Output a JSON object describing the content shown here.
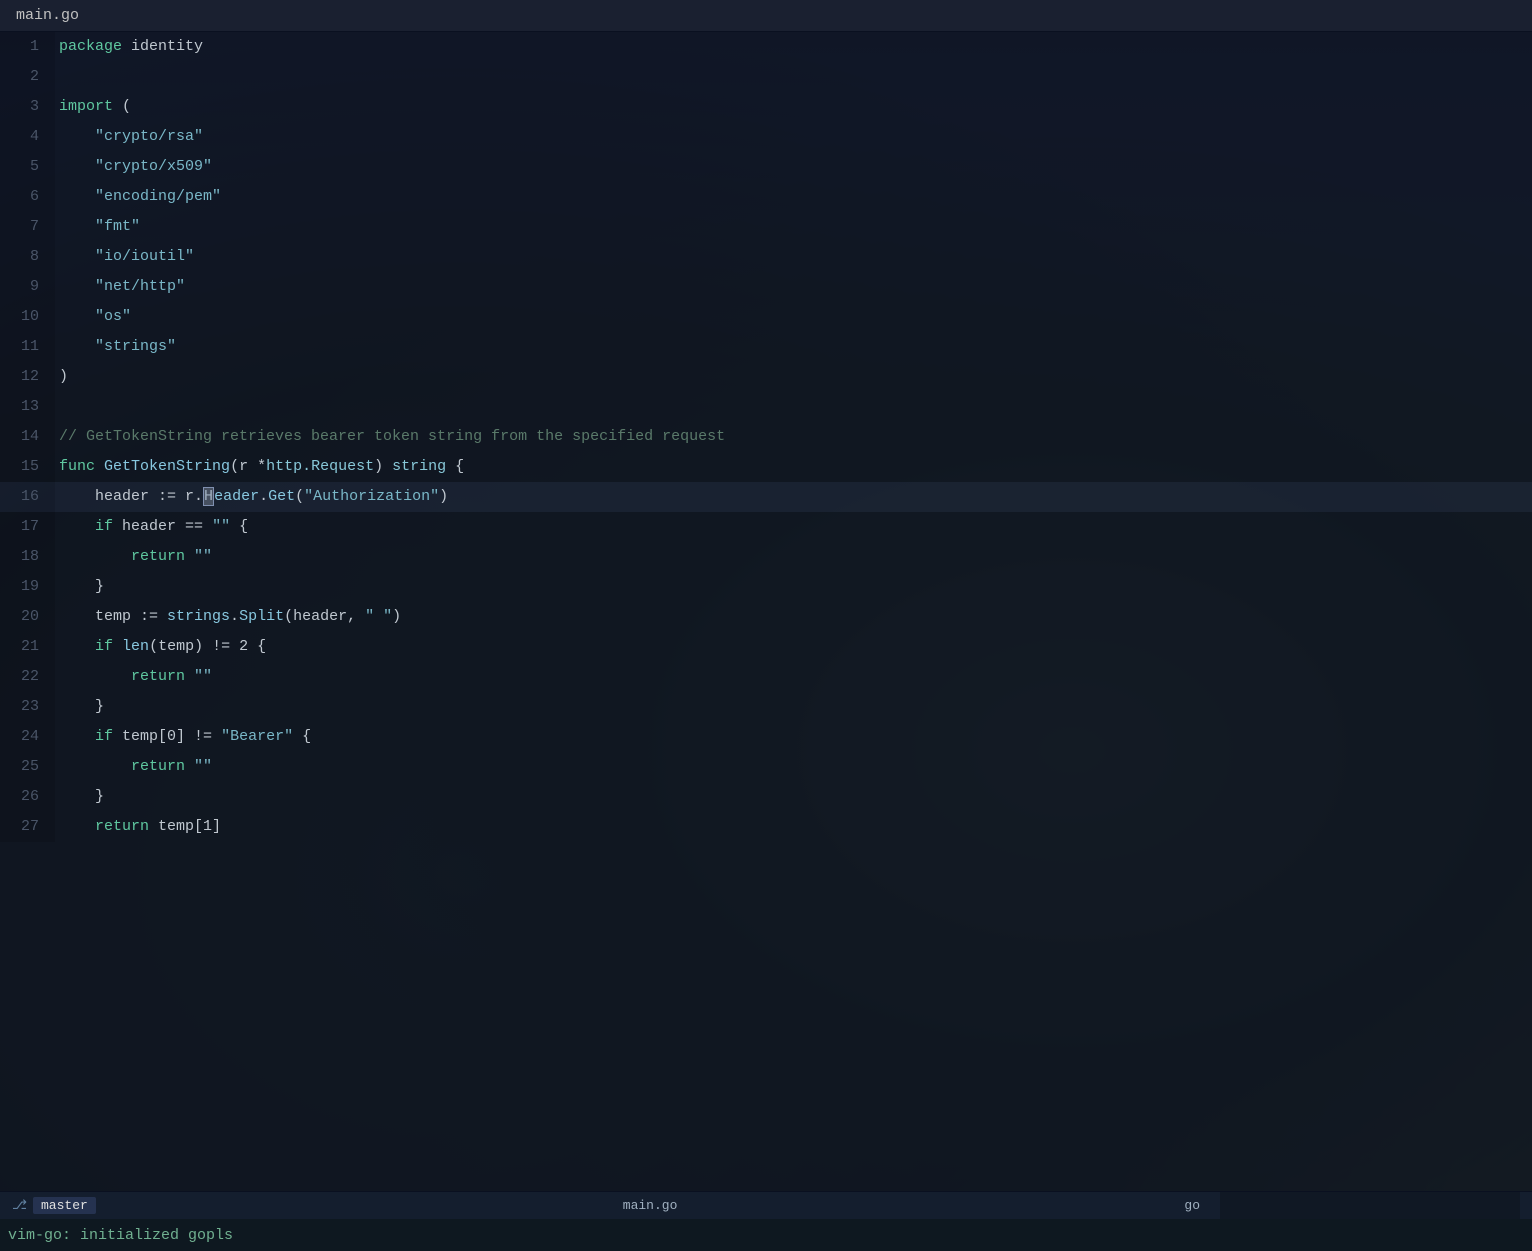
{
  "title_bar": {
    "label": "main.go"
  },
  "status_bar": {
    "branch_icon": "⎇",
    "branch_name": "master",
    "filename": "main.go",
    "filetype": "go"
  },
  "message_bar": {
    "text": "vim-go: initialized gopls"
  },
  "code": {
    "lines": [
      {
        "num": 1,
        "tokens": [
          {
            "t": "kw",
            "v": "package"
          },
          {
            "t": "plain",
            "v": " identity"
          }
        ]
      },
      {
        "num": 2,
        "tokens": []
      },
      {
        "num": 3,
        "tokens": [
          {
            "t": "kw",
            "v": "import"
          },
          {
            "t": "plain",
            "v": " ("
          }
        ]
      },
      {
        "num": 4,
        "tokens": [
          {
            "t": "plain",
            "v": "\t"
          },
          {
            "t": "str",
            "v": "\"crypto/rsa\""
          }
        ]
      },
      {
        "num": 5,
        "tokens": [
          {
            "t": "plain",
            "v": "\t"
          },
          {
            "t": "str",
            "v": "\"crypto/x509\""
          }
        ]
      },
      {
        "num": 6,
        "tokens": [
          {
            "t": "plain",
            "v": "\t"
          },
          {
            "t": "str",
            "v": "\"encoding/pem\""
          }
        ]
      },
      {
        "num": 7,
        "tokens": [
          {
            "t": "plain",
            "v": "\t"
          },
          {
            "t": "str",
            "v": "\"fmt\""
          }
        ]
      },
      {
        "num": 8,
        "tokens": [
          {
            "t": "plain",
            "v": "\t"
          },
          {
            "t": "str",
            "v": "\"io/ioutil\""
          }
        ]
      },
      {
        "num": 9,
        "tokens": [
          {
            "t": "plain",
            "v": "\t"
          },
          {
            "t": "str",
            "v": "\"net/http\""
          }
        ]
      },
      {
        "num": 10,
        "tokens": [
          {
            "t": "plain",
            "v": "\t"
          },
          {
            "t": "str",
            "v": "\"os\""
          }
        ]
      },
      {
        "num": 11,
        "tokens": [
          {
            "t": "plain",
            "v": "\t"
          },
          {
            "t": "str",
            "v": "\"strings\""
          }
        ]
      },
      {
        "num": 12,
        "tokens": [
          {
            "t": "plain",
            "v": ")"
          }
        ]
      },
      {
        "num": 13,
        "tokens": []
      },
      {
        "num": 14,
        "tokens": [
          {
            "t": "cm",
            "v": "// GetTokenString retrieves bearer token string from the specified request"
          }
        ]
      },
      {
        "num": 15,
        "tokens": [
          {
            "t": "kw",
            "v": "func"
          },
          {
            "t": "plain",
            "v": " "
          },
          {
            "t": "fn",
            "v": "GetTokenString"
          },
          {
            "t": "plain",
            "v": "(r *"
          },
          {
            "t": "type",
            "v": "http.Request"
          },
          {
            "t": "plain",
            "v": ") "
          },
          {
            "t": "type",
            "v": "string"
          },
          {
            "t": "plain",
            "v": " {"
          }
        ]
      },
      {
        "num": 16,
        "tokens": [
          {
            "t": "plain",
            "v": "\t"
          },
          {
            "t": "var",
            "v": "header"
          },
          {
            "t": "plain",
            "v": " := r."
          },
          {
            "t": "cursor",
            "v": ""
          },
          {
            "t": "fn",
            "v": "Header"
          },
          {
            "t": "plain",
            "v": "."
          },
          {
            "t": "fn",
            "v": "Get"
          },
          {
            "t": "plain",
            "v": "("
          },
          {
            "t": "str",
            "v": "\"Authorization\""
          },
          {
            "t": "plain",
            "v": ")"
          }
        ],
        "cursor": true
      },
      {
        "num": 17,
        "tokens": [
          {
            "t": "plain",
            "v": "\t"
          },
          {
            "t": "kw",
            "v": "if"
          },
          {
            "t": "plain",
            "v": " header == "
          },
          {
            "t": "str",
            "v": "\"\""
          },
          {
            "t": "plain",
            "v": " {"
          }
        ]
      },
      {
        "num": 18,
        "tokens": [
          {
            "t": "plain",
            "v": "\t\t"
          },
          {
            "t": "kw",
            "v": "return"
          },
          {
            "t": "plain",
            "v": " "
          },
          {
            "t": "str",
            "v": "\"\""
          }
        ]
      },
      {
        "num": 19,
        "tokens": [
          {
            "t": "plain",
            "v": "\t}"
          }
        ]
      },
      {
        "num": 20,
        "tokens": [
          {
            "t": "plain",
            "v": "\t"
          },
          {
            "t": "var",
            "v": "temp"
          },
          {
            "t": "plain",
            "v": " := "
          },
          {
            "t": "fn",
            "v": "strings"
          },
          {
            "t": "plain",
            "v": "."
          },
          {
            "t": "fn",
            "v": "Split"
          },
          {
            "t": "plain",
            "v": "(header, "
          },
          {
            "t": "str",
            "v": "\" \""
          },
          {
            "t": "plain",
            "v": ")"
          }
        ]
      },
      {
        "num": 21,
        "tokens": [
          {
            "t": "plain",
            "v": "\t"
          },
          {
            "t": "kw",
            "v": "if"
          },
          {
            "t": "plain",
            "v": " "
          },
          {
            "t": "fn",
            "v": "len"
          },
          {
            "t": "plain",
            "v": "(temp) != 2 {"
          }
        ]
      },
      {
        "num": 22,
        "tokens": [
          {
            "t": "plain",
            "v": "\t\t"
          },
          {
            "t": "kw",
            "v": "return"
          },
          {
            "t": "plain",
            "v": " "
          },
          {
            "t": "str",
            "v": "\"\""
          }
        ]
      },
      {
        "num": 23,
        "tokens": [
          {
            "t": "plain",
            "v": "\t}"
          }
        ]
      },
      {
        "num": 24,
        "tokens": [
          {
            "t": "plain",
            "v": "\t"
          },
          {
            "t": "kw",
            "v": "if"
          },
          {
            "t": "plain",
            "v": " temp[0] != "
          },
          {
            "t": "str",
            "v": "\"Bearer\""
          },
          {
            "t": "plain",
            "v": " {"
          }
        ]
      },
      {
        "num": 25,
        "tokens": [
          {
            "t": "plain",
            "v": "\t\t"
          },
          {
            "t": "kw",
            "v": "return"
          },
          {
            "t": "plain",
            "v": " "
          },
          {
            "t": "str",
            "v": "\"\""
          }
        ]
      },
      {
        "num": 26,
        "tokens": [
          {
            "t": "plain",
            "v": "\t}"
          }
        ]
      },
      {
        "num": 27,
        "tokens": [
          {
            "t": "plain",
            "v": "\t"
          },
          {
            "t": "kw",
            "v": "return"
          },
          {
            "t": "plain",
            "v": " temp[1]"
          }
        ]
      }
    ]
  }
}
